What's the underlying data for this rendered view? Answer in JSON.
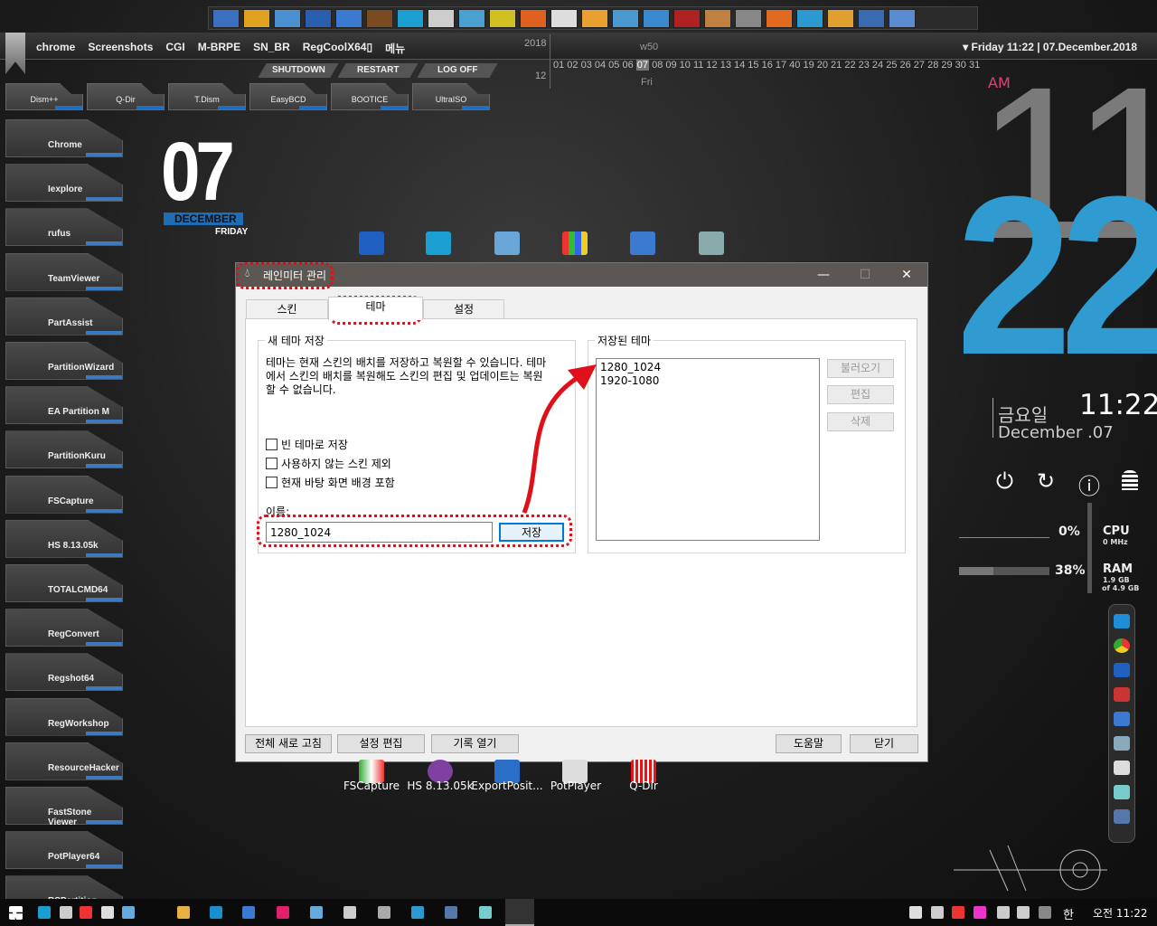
{
  "top_menu": {
    "items": [
      "chrome",
      "Screenshots",
      "CGI",
      "M-BRPE",
      "SN_BR",
      "RegCoolX64▯",
      "메뉴"
    ]
  },
  "power_buttons": [
    "SHUTDOWN",
    "RESTART",
    "LOG OFF"
  ],
  "tiles": [
    "Dism++",
    "Q-Dir",
    "T.Dism",
    "EasyBCD",
    "BOOTICE",
    "UltraISO"
  ],
  "sidebar": [
    "Chrome",
    "Iexplore",
    "rufus",
    "TeamViewer",
    "PartAssist",
    "PartitionWizard",
    "EA Partition M",
    "PartitionKuru",
    "FSCapture",
    "HS 8.13.05k",
    "TOTALCMD64",
    "RegConvert",
    "Regshot64",
    "RegWorkshop",
    "ResourceHacker",
    "FastStone Viewer",
    "PotPlayer64",
    "RSPartition"
  ],
  "calendar": {
    "year": "2018",
    "month": "12",
    "week": "w50",
    "days": "01 02 03 04 05 06",
    "today": "07",
    "days_after": "08 09 10 11 12 13 14 15 16 17 40 19 20 21 22 23 24 25 26 27 28 29 30 31",
    "weekday": "Fri",
    "header": "Friday 11:22 | 07.December.2018"
  },
  "date_widget": {
    "day": "07",
    "month": "DECEMBER",
    "weekday": "FRIDAY"
  },
  "clock": {
    "ampm": "AM",
    "hour": "11",
    "minute": "22",
    "weekday_ko": "금요일",
    "time": "11:22",
    "date": "December .07"
  },
  "sysmon": {
    "cpu_label": "CPU",
    "cpu_pct": "0%",
    "cpu_freq": "0 MHz",
    "ram_label": "RAM",
    "ram_pct": "38%",
    "ram_used": "1.9 GB",
    "ram_total": "of 4.9 GB",
    "ram_fraction": 0.38
  },
  "dialog": {
    "title": "레인미터 관리",
    "tabs": [
      "스킨",
      "테마",
      "설정"
    ],
    "active_tab": "테마",
    "new_group": "새 테마 저장",
    "desc": "테마는 현재 스킨의 배치를 저장하고 복원할 수 있습니다. 테마에서 스킨의 배치를 복원해도 스킨의 편집 및 업데이트는 복원 할 수 없습니다.",
    "checkboxes": [
      "빈 테마로 저장",
      "사용하지 않는 스킨 제외",
      "현재 바탕 화면 배경 포함"
    ],
    "name_label": "이름:",
    "name_value": "1280_1024",
    "save": "저장",
    "saved_group": "저장된 테마",
    "saved_list": [
      "1280_1024",
      "1920-1080"
    ],
    "side_buttons": [
      "불러오기",
      "편집",
      "삭제"
    ],
    "bottom_buttons": [
      "전체 새로 고침",
      "설정 편집",
      "기록 열기",
      "도움말",
      "닫기"
    ]
  },
  "desktop_icons": [
    "FSCapture",
    "HS 8.13.05k",
    "ExportPosit...",
    "PotPlayer",
    "Q-Dir"
  ],
  "taskbar": {
    "ime": "한",
    "clock": "오전 11:22"
  },
  "colors": {
    "accent_blue": "#2f9bd0",
    "highlight_red": "#e0101a",
    "ampm_pink": "#e0407a"
  }
}
